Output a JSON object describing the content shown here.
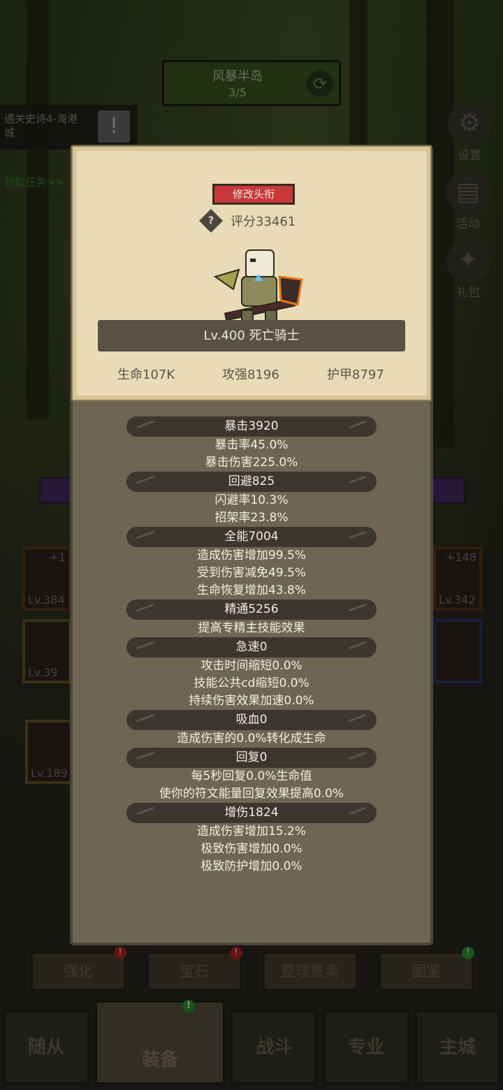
{
  "stage": {
    "name": "风暴半岛",
    "progress": "3/5"
  },
  "quest": {
    "text": "通关史诗4-海港城",
    "get_label": "领取任务>>"
  },
  "side_menu": [
    {
      "label": "设置"
    },
    {
      "label": "活动"
    },
    {
      "label": "礼包"
    }
  ],
  "equipment_bg": {
    "slots": [
      {
        "lv": "Lv.384",
        "plus": "+1"
      },
      {
        "lv": "Lv.342",
        "plus": "+148"
      },
      {
        "lv": "Lv.39",
        "plus": ""
      },
      {
        "lv": "Lv.189",
        "plus": ""
      }
    ]
  },
  "actions": [
    {
      "label": "强化",
      "badge": "!"
    },
    {
      "label": "宝石",
      "badge": "!"
    },
    {
      "label": "整理售卖",
      "badge": ""
    },
    {
      "label": "图鉴",
      "badge": "!"
    }
  ],
  "nav": [
    {
      "label": "随从"
    },
    {
      "label": "装备"
    },
    {
      "label": "战斗"
    },
    {
      "label": "专业"
    },
    {
      "label": "主城"
    }
  ],
  "card": {
    "change_title_button": "修改头衔",
    "score": "评分33461",
    "character": "Lv.400 死亡骑士",
    "hp": "生命107K",
    "attack": "攻强8196",
    "armor": "护甲8797"
  },
  "stat_groups": [
    {
      "title": "暴击3920",
      "lines": [
        "暴击率45.0%",
        "暴击伤害225.0%"
      ]
    },
    {
      "title": "回避825",
      "lines": [
        "闪避率10.3%",
        "招架率23.8%"
      ]
    },
    {
      "title": "全能7004",
      "lines": [
        "造成伤害增加99.5%",
        "受到伤害减免49.5%",
        "生命恢复增加43.8%"
      ]
    },
    {
      "title": "精通5256",
      "lines": [
        "提高专精主技能效果"
      ]
    },
    {
      "title": "急速0",
      "lines": [
        "攻击时间缩短0.0%",
        "技能公共cd缩短0.0%",
        "持续伤害效果加速0.0%"
      ]
    },
    {
      "title": "吸血0",
      "lines": [
        "造成伤害的0.0%转化成生命"
      ]
    },
    {
      "title": "回复0",
      "lines": [
        "每5秒回复0.0%生命值",
        "使你的符文能量回复效果提高0.0%"
      ]
    },
    {
      "title": "增伤1824",
      "lines": [
        "造成伤害增加15.2%",
        "极致伤害增加0.0%",
        "极致防护增加0.0%"
      ]
    }
  ]
}
